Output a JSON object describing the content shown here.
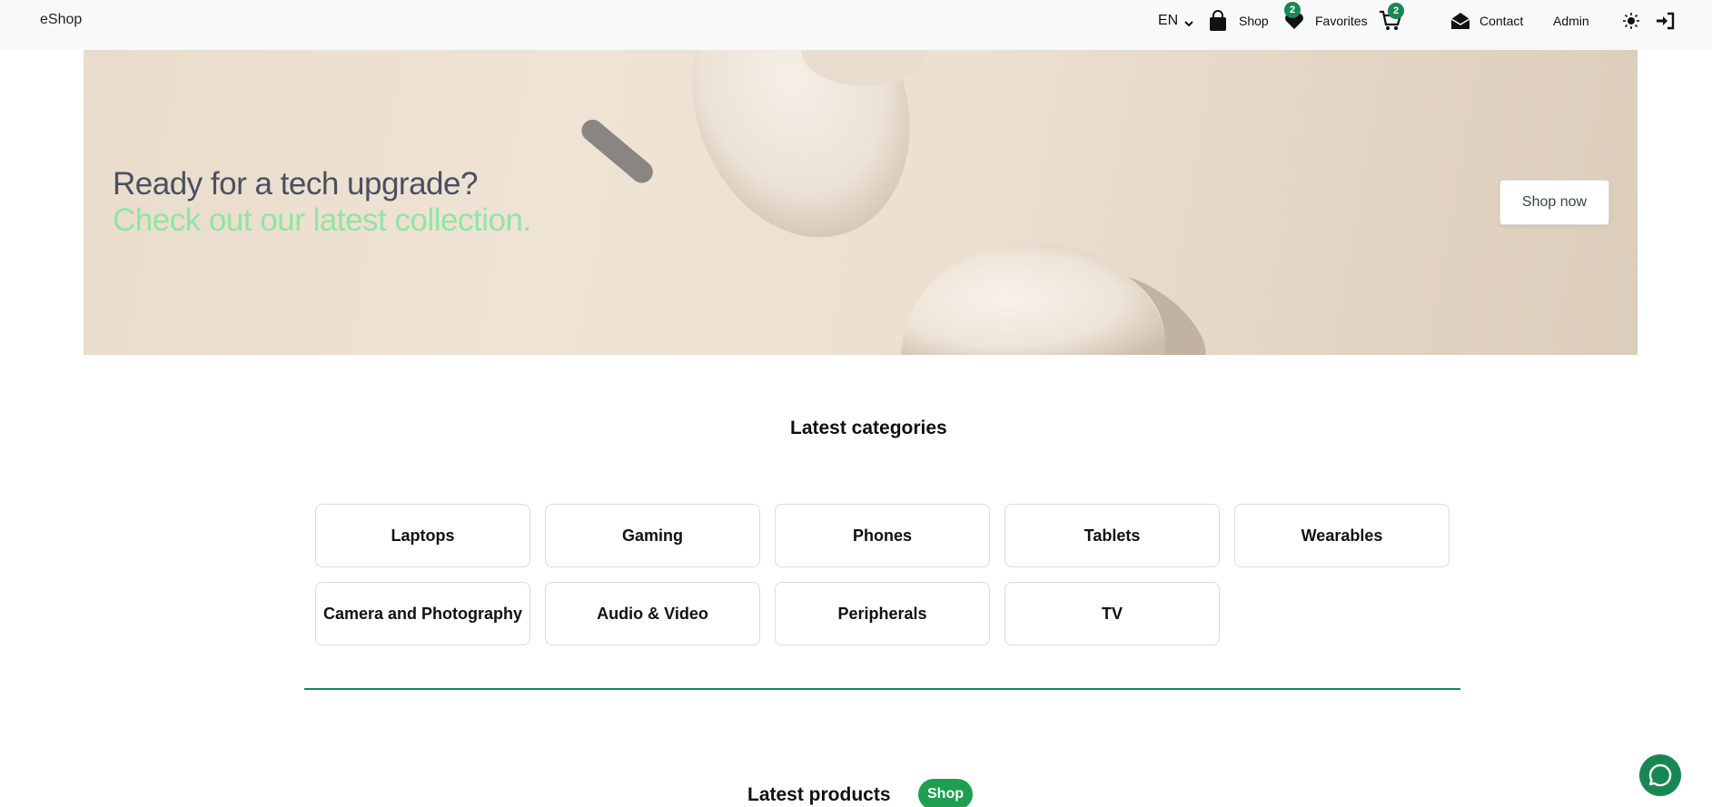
{
  "navbar": {
    "brand": "eShop",
    "language": "EN",
    "shop_label": "Shop",
    "favorites_label": "Favorites",
    "favorites_count": "2",
    "cart_count": "2",
    "contact_label": "Contact",
    "admin_label": "Admin",
    "icons": {
      "language_caret": "chevron-down-icon",
      "shop": "shopping-bag-icon",
      "favorites": "heart-icon",
      "cart": "cart-icon",
      "contact": "envelope-open-icon",
      "theme": "sun-icon",
      "login": "sign-in-icon"
    }
  },
  "hero": {
    "title": "Ready for a tech upgrade?",
    "subtitle": "Check out our latest collection.",
    "cta_label": "Shop now"
  },
  "categories": {
    "title": "Latest categories",
    "items": [
      "Laptops",
      "Gaming",
      "Phones",
      "Tablets",
      "Wearables",
      "Camera and Photography",
      "Audio & Video",
      "Peripherals",
      "TV"
    ]
  },
  "products": {
    "title": "Latest products",
    "shop_label": "Shop"
  },
  "chat": {
    "icon": "chat-bubble-icon"
  },
  "colors": {
    "accent": "#198754",
    "hero_title": "#4a5160",
    "hero_subtitle": "#8ee6a5",
    "navbar_bg": "#f8f9fb"
  }
}
